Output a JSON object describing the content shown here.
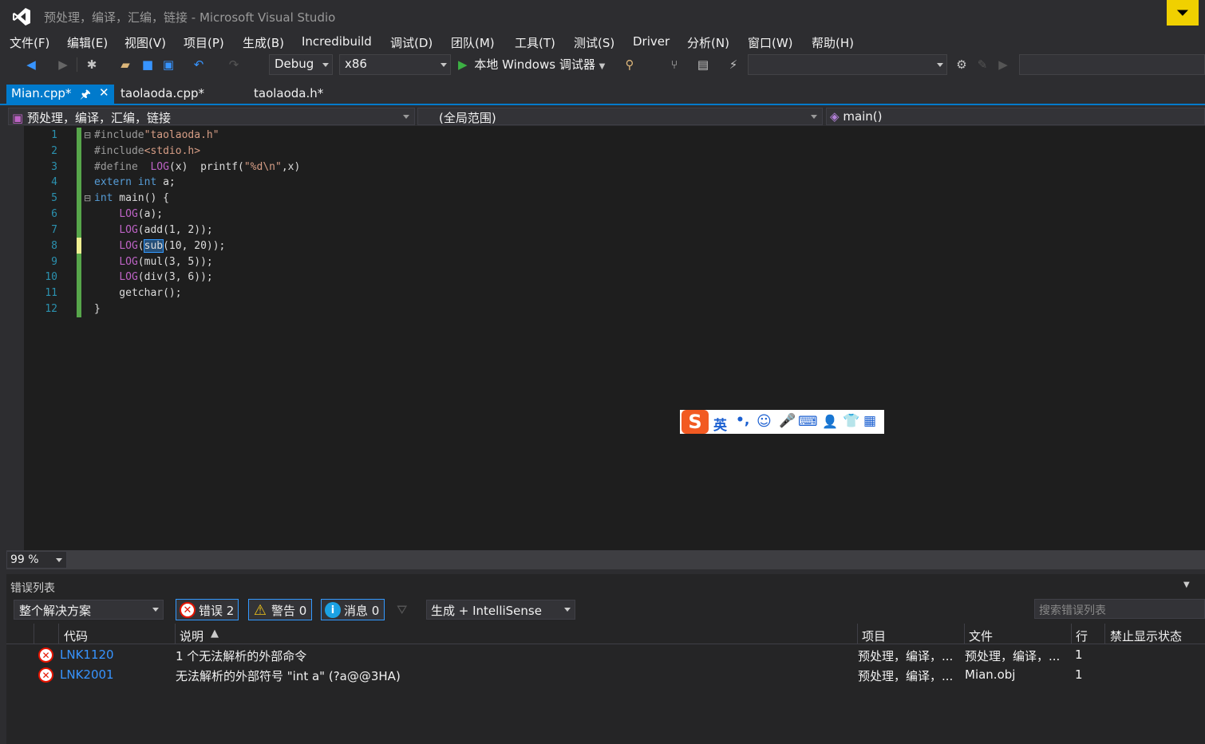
{
  "window": {
    "title": "预处理，编译，汇编，链接 - Microsoft Visual Studio"
  },
  "menu": [
    "文件(F)",
    "编辑(E)",
    "视图(V)",
    "项目(P)",
    "生成(B)",
    "Incredibuild",
    "调试(D)",
    "团队(M)",
    "工具(T)",
    "测试(S)",
    "Driver",
    "分析(N)",
    "窗口(W)",
    "帮助(H)"
  ],
  "toolbar": {
    "config": "Debug",
    "platform": "x86",
    "run_label": "本地 Windows 调试器"
  },
  "tabs": [
    {
      "label": "Mian.cpp*",
      "active": true
    },
    {
      "label": "taolaoda.cpp*",
      "active": false
    },
    {
      "label": "taolaoda.h*",
      "active": false
    }
  ],
  "navbar": {
    "project": "预处理，编译，汇编，链接",
    "scope": "(全局范围)",
    "member": "main()"
  },
  "editor": {
    "line_numbers": [
      "1",
      "2",
      "3",
      "4",
      "5",
      "6",
      "7",
      "8",
      "9",
      "10",
      "11",
      "12"
    ],
    "selected_text": "sub"
  },
  "zoom": "99 %",
  "error_list": {
    "title": "错误列表",
    "scope": "整个解决方案",
    "errors_label": "错误 2",
    "warnings_label": "警告 0",
    "messages_label": "消息 0",
    "source": "生成 + IntelliSense",
    "search_placeholder": "搜索错误列表",
    "columns": [
      "代码",
      "说明",
      "项目",
      "文件",
      "行",
      "禁止显示状态"
    ],
    "rows": [
      {
        "code": "LNK1120",
        "desc": "1 个无法解析的外部命令",
        "project": "预处理，编译，...",
        "file": "预处理，编译，...",
        "line": "1"
      },
      {
        "code": "LNK2001",
        "desc": "无法解析的外部符号 \"int a\" (?a@@3HA)",
        "project": "预处理，编译，...",
        "file": "Mian.obj",
        "line": "1"
      }
    ]
  },
  "ime": {
    "lang": "英"
  },
  "colors": {
    "accent": "#007acc",
    "error": "#e51400",
    "warning": "#f0c419",
    "info": "#1ba1e2"
  }
}
